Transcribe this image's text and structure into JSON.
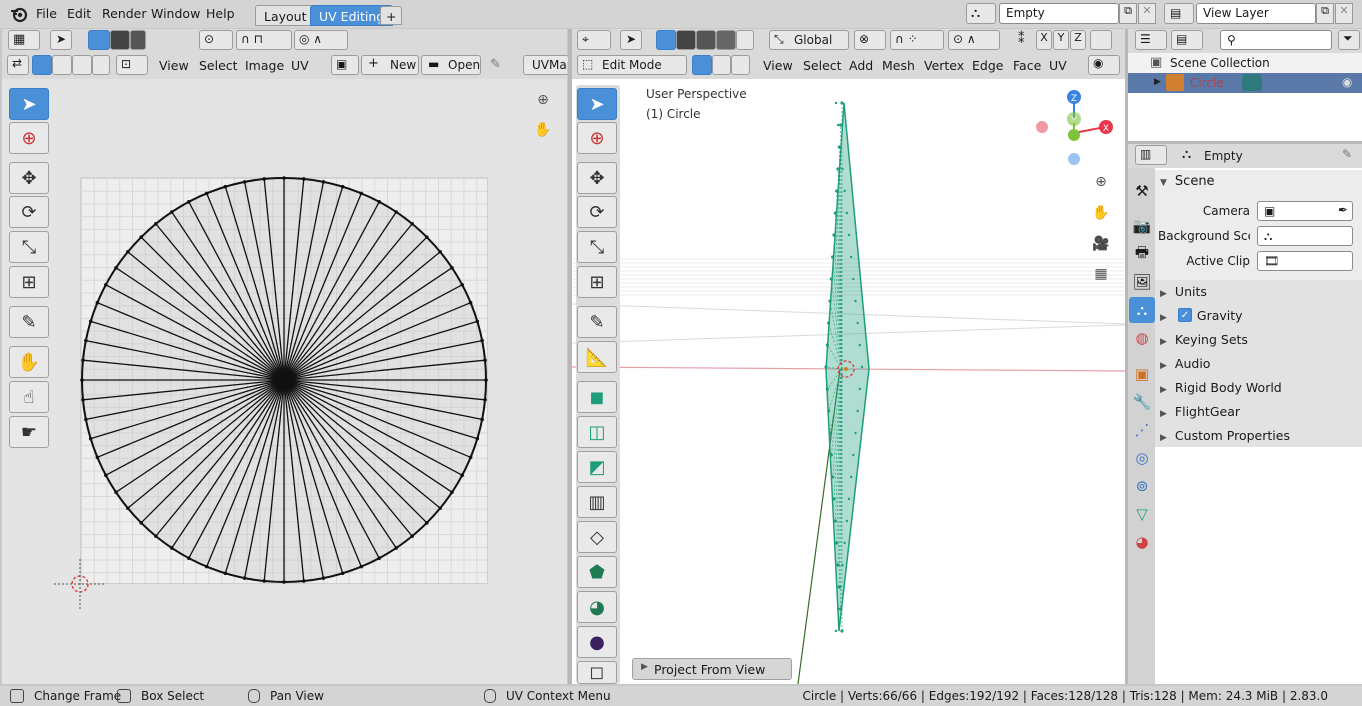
{
  "menubar": {
    "items": [
      "File",
      "Edit",
      "Render",
      "Window",
      "Help"
    ],
    "workspaces": [
      "Layout",
      "UV Editing"
    ],
    "add_tab": "+",
    "scene_field": "Empty",
    "view_layer_field": "View Layer"
  },
  "uv_editor": {
    "menus": [
      "View",
      "Select",
      "Image",
      "UV"
    ],
    "new_label": "New",
    "open_label": "Open",
    "uvmap_label": "UVMap",
    "tools": [
      "select",
      "cursor",
      "move",
      "rotate",
      "scale",
      "transform",
      "annotate",
      "grab",
      "relax",
      "pinch"
    ]
  },
  "viewport": {
    "mode": "Edit Mode",
    "orientation": "Global",
    "menus": [
      "View",
      "Select",
      "Add",
      "Mesh",
      "Vertex",
      "Edge",
      "Face",
      "UV"
    ],
    "overlay_title": "User Perspective",
    "overlay_object": "(1) Circle",
    "axis_labels": {
      "x": "X",
      "y": "Y",
      "z": "Z"
    },
    "xyz_buttons": [
      "X",
      "Y",
      "Z"
    ],
    "operator_panel": "Project From View"
  },
  "outliner": {
    "scene_collection": "Scene Collection",
    "child_label": "Circle"
  },
  "properties": {
    "header_object": "Empty",
    "section": "Scene",
    "camera_label": "Camera",
    "background_label": "Background Sce...",
    "active_clip_label": "Active Clip",
    "panels": [
      "Units",
      "Gravity",
      "Keying Sets",
      "Audio",
      "Rigid Body World",
      "FlightGear",
      "Custom Properties"
    ],
    "gravity_checked": true
  },
  "statusbar": {
    "change_frame": "Change Frame",
    "box_select": "Box Select",
    "pan_view": "Pan View",
    "context_menu": "UV Context Menu",
    "stats": "Circle | Verts:66/66 | Edges:192/192 | Faces:128/128 | Tris:128 | Mem: 24.3 MiB | 2.83.0"
  },
  "colors": {
    "accent": "#4a90d9",
    "mesh": "#1e9e7a",
    "axis_x": "#e8364a",
    "axis_y": "#7cc43a",
    "axis_z": "#3a82e0"
  }
}
